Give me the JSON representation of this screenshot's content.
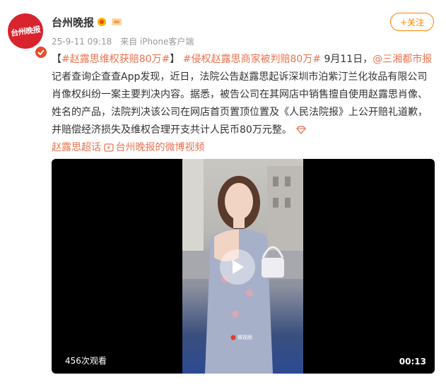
{
  "post": {
    "account_name": "台州晚报",
    "avatar_text": "台州晚报",
    "timestamp": "25-9-11 09:18",
    "source": "来自 iPhone客户端",
    "follow_label": "+关注",
    "hashtag1": "#赵露思维权获赔80万#",
    "hashtag2": "#侵权赵露思商家被判赔80万#",
    "date_text": "9月11日，",
    "mention": "@三湘都市报",
    "body": "记者查询企查查App发现，近日，法院公告赵露思起诉深圳市泊紫汀兰化妆品有限公司肖像权纠纷一案主要判决内容。据悉，被告公司在其网店中销售擅自使用赵露思肖像、姓名的产品，法院判决该公司在网店首页置顶位置及《人民法院报》上公开赔礼道歉，并赔偿经济损失及维权合理开支共计人民币80万元整。",
    "topic_link": "赵露思超话",
    "video_link": "台州晚报的微博视频"
  },
  "video": {
    "views": "456次观看",
    "duration": "00:13",
    "watermark": "微视频"
  },
  "colors": {
    "accent": "#ff8200",
    "link": "#eb7350",
    "avatar_bg": "#d9232d"
  }
}
